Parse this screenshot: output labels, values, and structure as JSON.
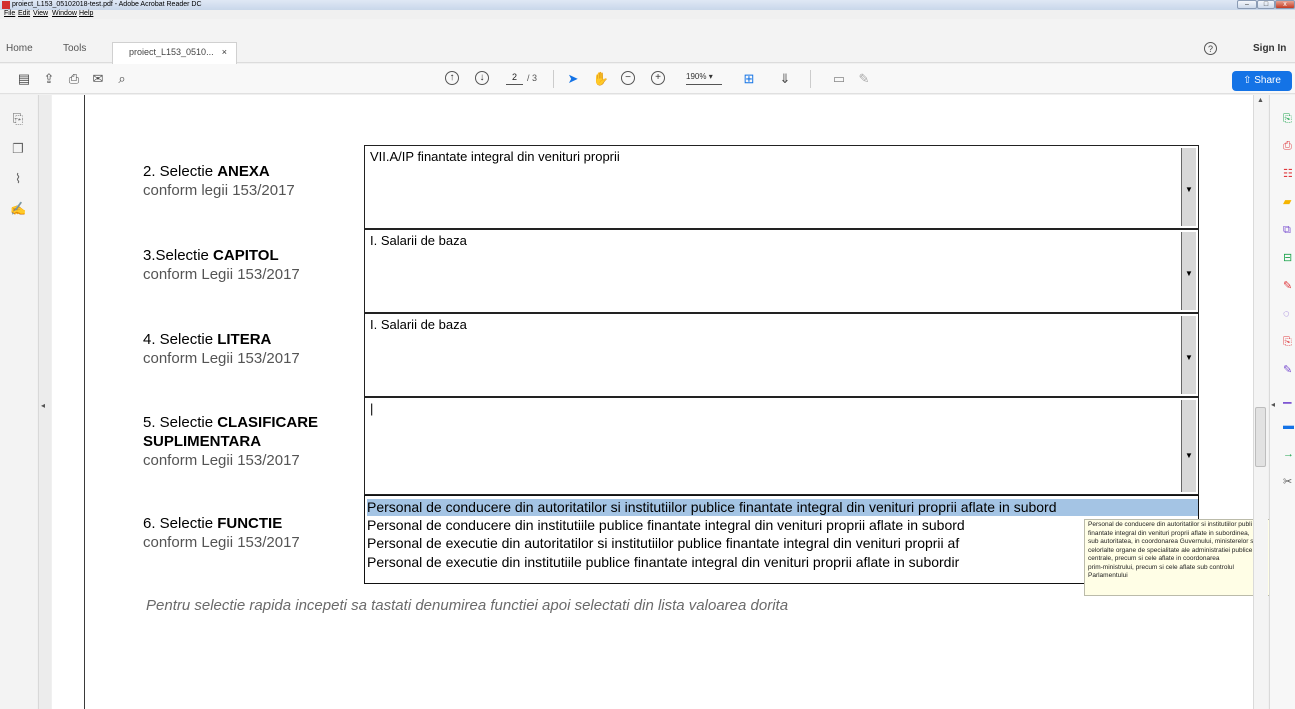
{
  "window": {
    "title": "proiect_L153_05102018-test.pdf - Adobe Acrobat Reader DC",
    "controls": {
      "minimize": "–",
      "maximize": "□",
      "close": "x"
    }
  },
  "menu": [
    "File",
    "Edit",
    "View",
    "Window",
    "Help"
  ],
  "nav": {
    "home": "Home",
    "tools": "Tools",
    "doc_tab": "proiect_L153_0510...",
    "tab_close": "×",
    "help": "?",
    "sign_in": "Sign In"
  },
  "toolbar": {
    "page_current": "2",
    "page_total": "/ 3",
    "zoom": "190%",
    "share": "Share"
  },
  "form": {
    "anexa": {
      "num": "2. Selectie ",
      "bold": "ANEXA",
      "sub": "conform legii 153/2017",
      "value": "VII.A/IP finantate integral din venituri proprii"
    },
    "capitol": {
      "num": "3.Selectie ",
      "bold": "CAPITOL",
      "sub": "conform Legii 153/2017",
      "value": "I. Salarii de baza"
    },
    "litera": {
      "num": "4. Selectie ",
      "bold": "LITERA",
      "sub": "conform Legii 153/2017",
      "value": "I. Salarii de baza"
    },
    "clasificare": {
      "num": "5. Selectie ",
      "bold": "CLASIFICARE",
      "bold2": "SUPLIMENTARA",
      "sub": "conform Legii 153/2017",
      "value": "|"
    },
    "functie": {
      "num": "6.  Selectie ",
      "bold": "FUNCTIE",
      "sub": "conform Legii 153/2017",
      "options": [
        "Personal de conducere din autoritatilor si institutiilor publice finantate integral din venituri proprii aflate in subord",
        "Personal de conducere din institutiile publice finantate integral din venituri proprii aflate in subord",
        "Personal de executie din autoritatilor si institutiilor publice finantate integral din venituri proprii af",
        "Personal de executie din institutiile publice finantate integral din venituri proprii aflate in subordir"
      ],
      "selected_index": 0
    },
    "hint": "Pentru selectie rapida incepeti sa tastati denumirea functiei apoi selectati din lista valoarea dorita"
  },
  "tooltip": [
    "Personal de conducere din autoritatilor si institutiilor publi",
    "finantate integral din venituri proprii aflate in subordinea,",
    "sub autoritatea, in coordonarea Guvernului, ministerelor si",
    "celorlalte organe de specialitate ale administratiei publice",
    "centrale, precum si cele aflate in coordonarea",
    "prim-ministrului, precum si cele aflate sub controlul",
    "Parlamentului"
  ],
  "colors": {
    "accent": "#1473e6",
    "selection": "#a4c4e4",
    "tooltip_bg": "#fffee6"
  }
}
